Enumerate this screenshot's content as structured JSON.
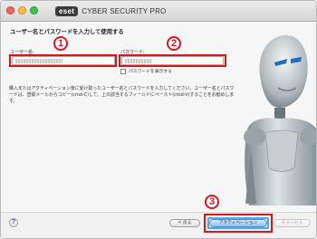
{
  "window": {
    "logo_text": "eset",
    "app_name": "CYBER SECURITY PRO"
  },
  "heading": "ユーザー名とパスワードを入力して使用する",
  "username": {
    "label": "ユーザー名:",
    "value": ""
  },
  "password": {
    "label": "パスワード:",
    "value": ""
  },
  "show_password": {
    "label": "パスワードを表示する",
    "checked": false
  },
  "info_text": "購入またはアクティベーション後に受け取ったユーザー名とパスワードを入力してください。ユーザー名とパスワードは、登録メールからコピー(cmd-C)して、上の該当するフィールドにペースト(cmd-V)することをお勧めします。",
  "annotations": {
    "badge_1": "1",
    "badge_2": "2",
    "badge_3": "3",
    "highlight_color": "#d9161d"
  },
  "footer": {
    "help_label": "?",
    "back_label": "< 戻る",
    "activate_label": "アクティベーション",
    "cancel_label": "キャンセル"
  },
  "icons": {
    "help": "help-icon",
    "mascot": "robot-mascot"
  }
}
